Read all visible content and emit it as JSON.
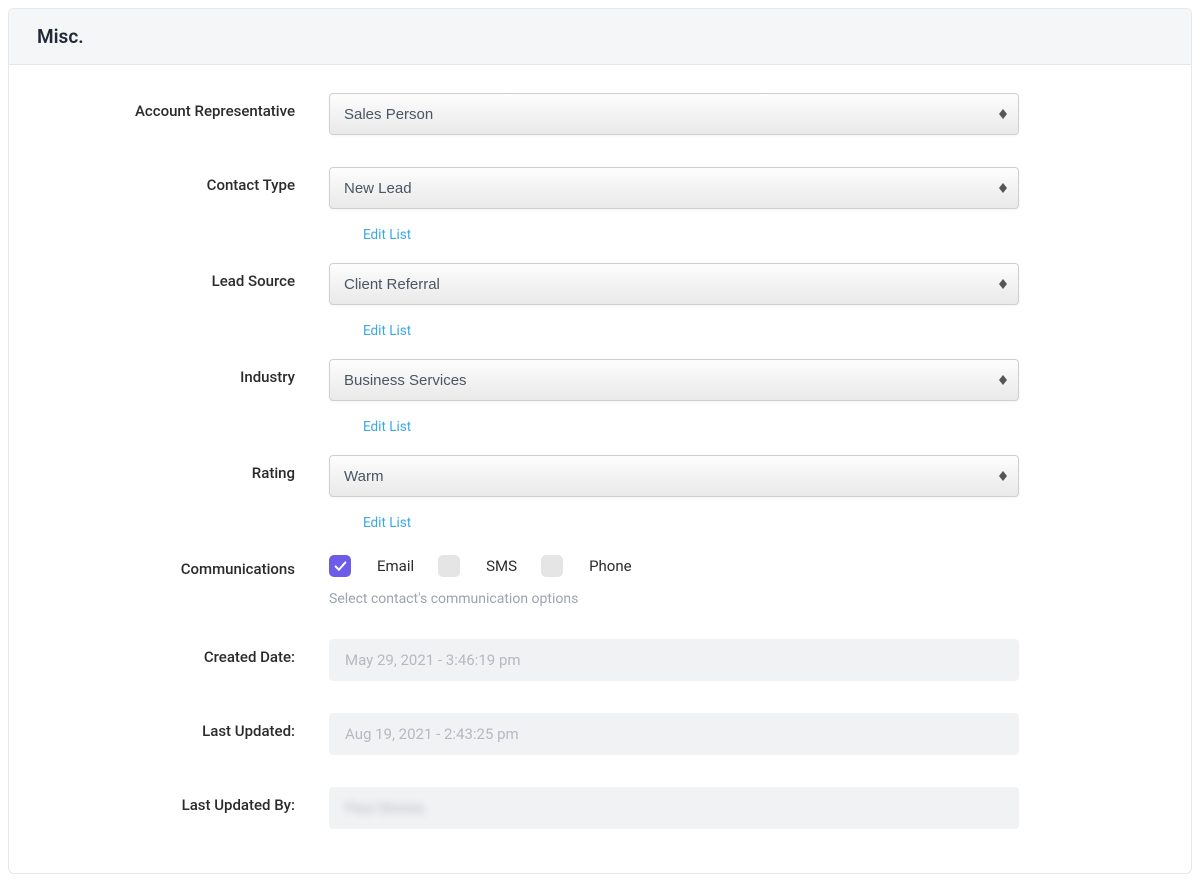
{
  "panel": {
    "title": "Misc."
  },
  "fields": {
    "account_rep": {
      "label": "Account Representative",
      "value": "Sales Person"
    },
    "contact_type": {
      "label": "Contact Type",
      "value": "New Lead",
      "edit_link": "Edit List"
    },
    "lead_source": {
      "label": "Lead Source",
      "value": "Client Referral",
      "edit_link": "Edit List"
    },
    "industry": {
      "label": "Industry",
      "value": "Business Services",
      "edit_link": "Edit List"
    },
    "rating": {
      "label": "Rating",
      "value": "Warm",
      "edit_link": "Edit List"
    },
    "communications": {
      "label": "Communications",
      "options": {
        "email": {
          "label": "Email",
          "checked": true
        },
        "sms": {
          "label": "SMS",
          "checked": false
        },
        "phone": {
          "label": "Phone",
          "checked": false
        }
      },
      "help": "Select contact's communication options"
    },
    "created_date": {
      "label": "Created Date:",
      "value": "May 29, 2021 - 3:46:19 pm"
    },
    "last_updated": {
      "label": "Last Updated:",
      "value": "Aug 19, 2021 - 2:43:25 pm"
    },
    "last_updated_by": {
      "label": "Last Updated By:",
      "value": "Paul Stones"
    }
  }
}
